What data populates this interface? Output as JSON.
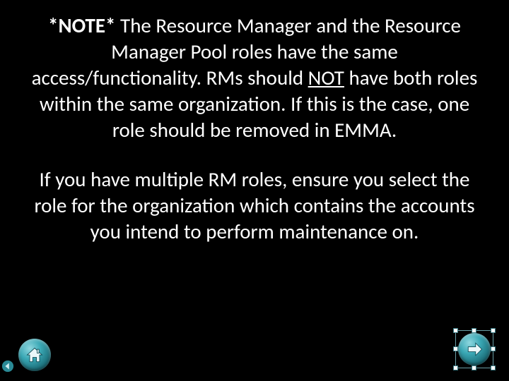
{
  "slide": {
    "note_prefix": "*NOTE*",
    "para1_a": " The Resource Manager and the Resource Manager Pool roles have the same access/functionality.  RMs should ",
    "para1_not": "NOT",
    "para1_b": " have both roles within the same organization.  If this is the case, one role should be removed in EMMA.",
    "para2": "If you have multiple RM roles, ensure you select the role for the organization which contains the accounts you intend to perform maintenance on."
  },
  "nav": {
    "home": "Home",
    "next": "Next",
    "back": "Back"
  },
  "colors": {
    "bg": "#000000",
    "text": "#ffffff",
    "button_accent": "#3aa8b5"
  }
}
